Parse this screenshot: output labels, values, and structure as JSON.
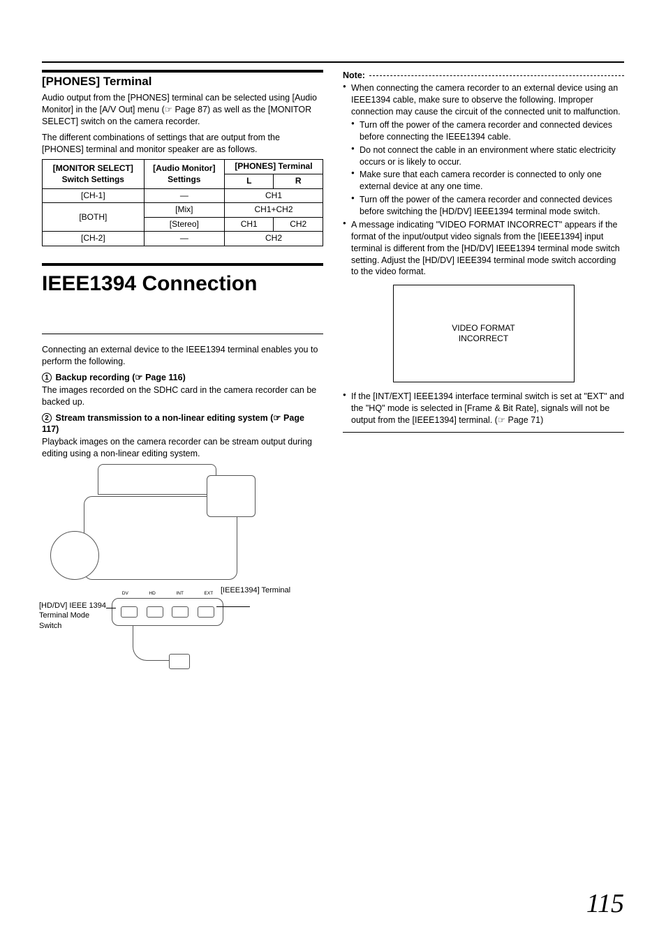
{
  "left": {
    "phones_heading": "[PHONES] Terminal",
    "phones_p1": "Audio output from the [PHONES] terminal can be selected using [Audio Monitor] in the [A/V Out] menu (☞ Page 87) as well as the [MONITOR SELECT] switch on the camera recorder.",
    "phones_p2": "The different combinations of settings that are output from the [PHONES] terminal and monitor speaker are as follows.",
    "table": {
      "h1a": "[MONITOR SELECT]",
      "h1b": "Switch Settings",
      "h2a": "[Audio Monitor]",
      "h2b": "Settings",
      "h3": "[PHONES] Terminal",
      "h3l": "L",
      "h3r": "R",
      "r1c1": "[CH-1]",
      "r1c2": "—",
      "r1c3": "CH1",
      "r2c1": "[BOTH]",
      "r2c2": "[Mix]",
      "r2c3": "CH1+CH2",
      "r3c2": "[Stereo]",
      "r3c3l": "CH1",
      "r3c3r": "CH2",
      "r4c1": "[CH-2]",
      "r4c2": "—",
      "r4c3": "CH2"
    },
    "ieee_heading": "IEEE1394 Connection",
    "ieee_intro": "Connecting an external device to the IEEE1394 terminal enables you to perform the following.",
    "item1_num": "1",
    "item1_label": "Backup recording (☞ Page 116)",
    "item1_body": "The images recorded on the SDHC card in the camera recorder can be backed up.",
    "item2_num": "2",
    "item2_label": "Stream transmission to a non-linear editing system (☞ Page 117)",
    "item2_body": "Playback images on the camera recorder can be stream output during editing using a non-linear editing system.",
    "diagram": {
      "callout1": "[IEEE1394] Terminal",
      "callout2": "[HD/DV] IEEE 1394 Terminal Mode Switch",
      "ports": {
        "a": "DV",
        "b": "HD",
        "c": "INT",
        "d": "EXT"
      }
    }
  },
  "right": {
    "note_label": "Note:",
    "b1": "When connecting the camera recorder to an external device using an IEEE1394 cable, make sure to observe the following. Improper connection may cause the circuit of the connected unit to malfunction.",
    "b1s1": "Turn off the power of the camera recorder and connected devices before connecting the IEEE1394 cable.",
    "b1s2": "Do not connect the cable in an environment where static electricity occurs or is likely to occur.",
    "b1s3": "Make sure that each camera recorder is connected to only one external device at any one time.",
    "b1s4": "Turn off the power of the camera recorder and connected devices before switching the [HD/DV] IEEE1394 terminal mode switch.",
    "b2": "A message indicating \"VIDEO FORMAT INCORRECT\" appears if the format of the input/output video signals from the [IEEE1394] input terminal is different from the [HD/DV] IEEE1394 terminal mode switch setting. Adjust the [HD/DV] IEEE394 terminal mode switch according to the video format.",
    "screen_l1": "VIDEO FORMAT",
    "screen_l2": "INCORRECT",
    "b3": "If the [INT/EXT] IEEE1394 interface terminal switch is set at \"EXT\" and the \"HQ\" mode is selected in [Frame & Bit Rate], signals will not be output from the [IEEE1394] terminal. (☞ Page 71)"
  },
  "page_number": "115"
}
